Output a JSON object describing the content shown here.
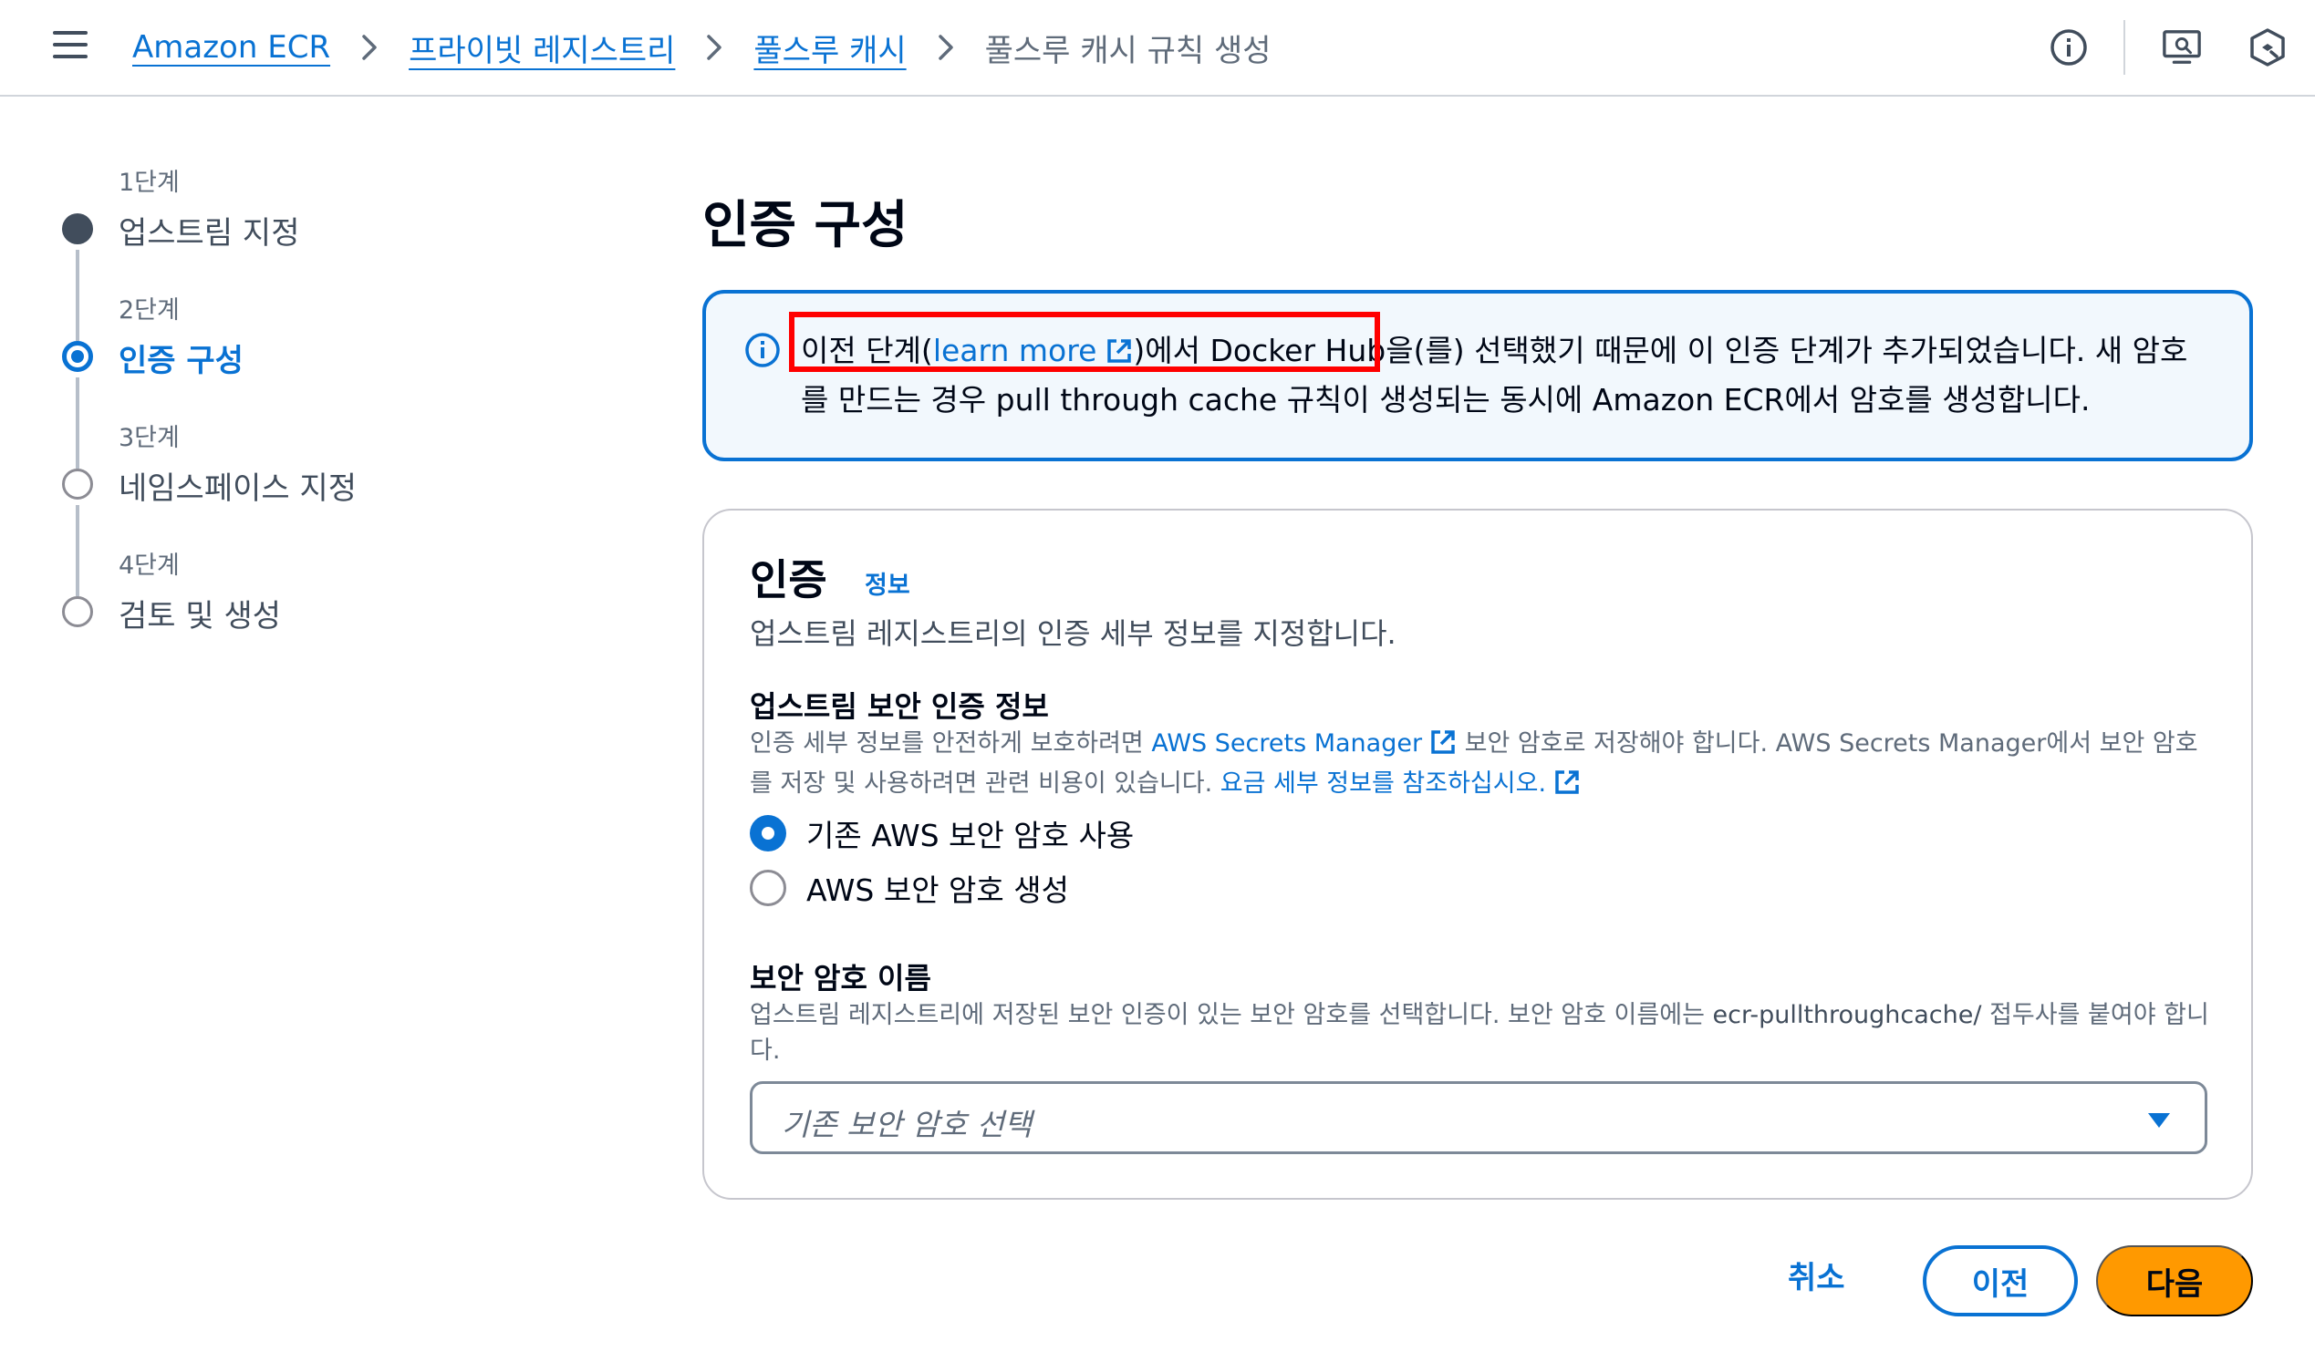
{
  "breadcrumb": {
    "items": [
      {
        "label": "Amazon ECR"
      },
      {
        "label": "프라이빗 레지스트리"
      },
      {
        "label": "풀스루 캐시"
      }
    ],
    "current": "풀스루 캐시 규칙 생성"
  },
  "steps": [
    {
      "label": "1단계",
      "name": "업스트림 지정",
      "state": "done"
    },
    {
      "label": "2단계",
      "name": "인증 구성",
      "state": "current"
    },
    {
      "label": "3단계",
      "name": "네임스페이스 지정",
      "state": "todo"
    },
    {
      "label": "4단계",
      "name": "검토 및 생성",
      "state": "todo"
    }
  ],
  "page_title": "인증 구성",
  "alert": {
    "prefix": "이전 단계(",
    "link": "learn more",
    "middle": ")에서 Docker Hub",
    "suffix": "을(를) 선택했기 때문에 이 인증 단계가 추가되었습니다. 새 암호를 만드는 경우 pull through cache 규칙이 생성되는 동시에 Amazon ECR에서 암호를 생성합니다."
  },
  "panel": {
    "title": "인증",
    "info_link": "정보",
    "description": "업스트림 레지스트리의 인증 세부 정보를 지정합니다.",
    "credentials": {
      "label": "업스트림 보안 인증 정보",
      "desc_part1": "인증 세부 정보를 안전하게 보호하려면 ",
      "desc_link1": "AWS Secrets Manager",
      "desc_part2": " 보안 암호로 저장해야 합니다. AWS Secrets Manager에서 보안 암호를 저장 및 사용하려면 관련 비용이 있습니다. ",
      "desc_link2": "요금 세부 정보를 참조하십시오.",
      "options": [
        {
          "label": "기존 AWS 보안 암호 사용",
          "checked": true
        },
        {
          "label": "AWS 보안 암호 생성",
          "checked": false
        }
      ]
    },
    "secret_name": {
      "label": "보안 암호 이름",
      "desc_part1": "업스트림 레지스트리에 저장된 보안 인증이 있는 보안 암호를 선택합니다. 보안 암호 이름에는 ",
      "desc_code": "ecr-pullthroughcache/",
      "desc_part2": " 접두사를 붙여야 합니다.",
      "placeholder": "기존 보안 암호 선택"
    }
  },
  "actions": {
    "cancel": "취소",
    "previous": "이전",
    "next": "다음"
  },
  "colors": {
    "link": "#0972d3",
    "primary_button": "#ff9900",
    "highlight": "#ff0000",
    "alert_bg": "#f2f8fd"
  }
}
